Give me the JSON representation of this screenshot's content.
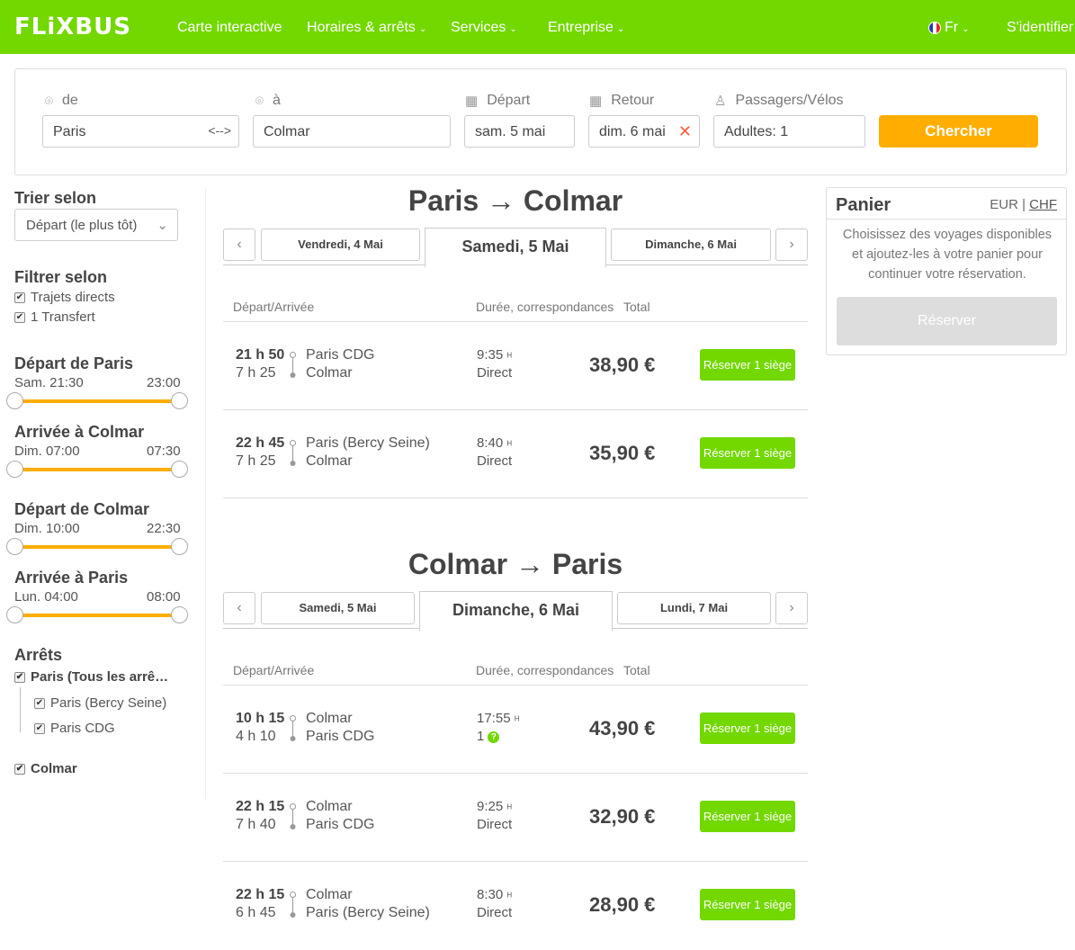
{
  "header": {
    "logo": "FLiXBUS",
    "nav": [
      "Carte interactive",
      "Horaires & arrêts",
      "Services",
      "Entreprise"
    ],
    "lang": "Fr",
    "login": "S'identifier"
  },
  "search": {
    "from_label": "de",
    "from_value": "Paris",
    "to_label": "à",
    "to_value": "Colmar",
    "depart_label": "Départ",
    "depart_value": "sam. 5 mai",
    "return_label": "Retour",
    "return_value": "dim. 6 mai",
    "pax_label": "Passagers/Vélos",
    "pax_value": "Adultes: 1",
    "button": "Chercher"
  },
  "sidebar": {
    "sort_title": "Trier selon",
    "sort_value": "Départ (le plus tôt)",
    "filter_title": "Filtrer selon",
    "filters": [
      "Trajets directs",
      "1 Transfert"
    ],
    "ranges": [
      {
        "title": "Départ de Paris",
        "min": "Sam. 21:30",
        "max": "23:00"
      },
      {
        "title": "Arrivée à Colmar",
        "min": "Dim. 07:00",
        "max": "07:30"
      },
      {
        "title": "Départ de Colmar",
        "min": "Dim. 10:00",
        "max": "22:30"
      },
      {
        "title": "Arrivée à Paris",
        "min": "Lun. 04:00",
        "max": "08:00"
      }
    ],
    "stops_title": "Arrêts",
    "stops": {
      "paris_all": "Paris (Tous les arrê…",
      "paris_bercy": "Paris (Bercy Seine)",
      "paris_cdg": "Paris CDG",
      "colmar": "Colmar"
    }
  },
  "outbound": {
    "title": "Paris → Colmar",
    "tab_prev": "Vendredi, 4 Mai",
    "tab_active": "Samedi, 5 Mai",
    "tab_next": "Dimanche, 6 Mai",
    "col1": "Départ/Arrivée",
    "col2": "Durée, correspondances",
    "col3": "Total",
    "rows": [
      {
        "time": "21 h 50",
        "dur": "7 h 25",
        "from": "Paris CDG",
        "to": "Colmar",
        "ddur": "9:35",
        "type": "Direct",
        "price": "38,90 €",
        "book": "Réserver 1 siège"
      },
      {
        "time": "22 h 45",
        "dur": "7 h 25",
        "from": "Paris (Bercy Seine)",
        "to": "Colmar",
        "ddur": "8:40",
        "type": "Direct",
        "price": "35,90 €",
        "book": "Réserver 1 siège"
      }
    ]
  },
  "inbound": {
    "title": "Colmar → Paris",
    "tab_prev": "Samedi, 5 Mai",
    "tab_active": "Dimanche, 6 Mai",
    "tab_next": "Lundi, 7 Mai",
    "col1": "Départ/Arrivée",
    "col2": "Durée, correspondances",
    "col3": "Total",
    "rows": [
      {
        "time": "10 h 15",
        "dur": "4 h 10",
        "from": "Colmar",
        "to": "Paris CDG",
        "ddur": "17:55",
        "type": "1",
        "price": "43,90 €",
        "book": "Réserver 1 siège"
      },
      {
        "time": "22 h 15",
        "dur": "7 h 40",
        "from": "Colmar",
        "to": "Paris CDG",
        "ddur": "9:25",
        "type": "Direct",
        "price": "32,90 €",
        "book": "Réserver 1 siège"
      },
      {
        "time": "22 h 15",
        "dur": "6 h 45",
        "from": "Colmar",
        "to": "Paris (Bercy Seine)",
        "ddur": "8:30",
        "type": "Direct",
        "price": "28,90 €",
        "book": "Réserver 1 siège"
      }
    ]
  },
  "cart": {
    "title": "Panier",
    "cur_eur": "EUR",
    "cur_sep": "|",
    "cur_chf": "CHF",
    "text": "Choisissez des voyages disponibles et ajoutez-les à votre panier pour continuer votre réservation.",
    "button": "Réserver"
  },
  "colors": {
    "brand": "#73d700",
    "accent": "#ffad00"
  }
}
